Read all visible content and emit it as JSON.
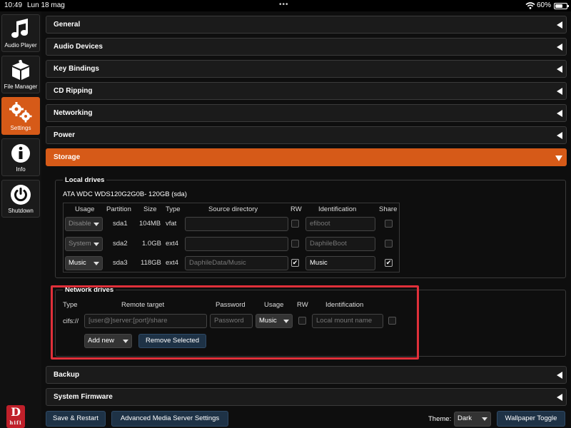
{
  "status": {
    "time": "10:49",
    "date": "Lun 18 mag",
    "dots": "•••",
    "battery": "60%"
  },
  "sidebar": {
    "items": [
      {
        "label": "Audio Player",
        "icon": "music-note-icon"
      },
      {
        "label": "File Manager",
        "icon": "box-icon"
      },
      {
        "label": "Settings",
        "icon": "gears-icon"
      },
      {
        "label": "Info",
        "icon": "info-icon"
      },
      {
        "label": "Shutdown",
        "icon": "power-icon"
      }
    ],
    "logo_letter": "D",
    "logo_sub": "hifi"
  },
  "panels": {
    "general": "General",
    "audio_devices": "Audio Devices",
    "key_bindings": "Key Bindings",
    "cd_ripping": "CD Ripping",
    "networking": "Networking",
    "power": "Power",
    "storage": "Storage",
    "backup": "Backup",
    "system_firmware": "System Firmware"
  },
  "local_drives": {
    "title": "Local drives",
    "disk_name": "ATA WDC WDS120G2G0B- 120GB (sda)",
    "headers": {
      "usage": "Usage",
      "partition": "Partition",
      "size": "Size",
      "type": "Type",
      "source_directory": "Source directory",
      "rw": "RW",
      "identification": "Identification",
      "share": "Share"
    },
    "rows": [
      {
        "usage": "Disable",
        "partition": "sda1",
        "size": "104MB",
        "type": "vfat",
        "source": "",
        "rw": "",
        "identification": "efiboot",
        "share": ""
      },
      {
        "usage": "System",
        "partition": "sda2",
        "size": "1.0GB",
        "type": "ext4",
        "source": "",
        "rw": "",
        "identification": "DaphileBoot",
        "share": ""
      },
      {
        "usage": "Music",
        "partition": "sda3",
        "size": "118GB",
        "type": "ext4",
        "source": "DaphileData/Music",
        "rw": "✔",
        "identification": "Music",
        "share": "✔"
      }
    ]
  },
  "network_drives": {
    "title": "Network drives",
    "headers": {
      "type": "Type",
      "remote_target": "Remote target",
      "password": "Password",
      "usage": "Usage",
      "rw": "RW",
      "identification": "Identification"
    },
    "row": {
      "type": "cifs://",
      "remote_placeholder": "[user@]server:[port]/share",
      "password_placeholder": "Password",
      "usage": "Music",
      "identification_placeholder": "Local mount name"
    },
    "add_new": "Add new",
    "remove_selected": "Remove Selected"
  },
  "footer": {
    "save_restart": "Save & Restart",
    "advanced": "Advanced Media Server Settings",
    "theme_label": "Theme:",
    "theme_value": "Dark",
    "wallpaper_toggle": "Wallpaper Toggle"
  },
  "colors": {
    "accent": "#d65a18",
    "highlight": "#e0303a",
    "button_blue": "#1e3246"
  }
}
